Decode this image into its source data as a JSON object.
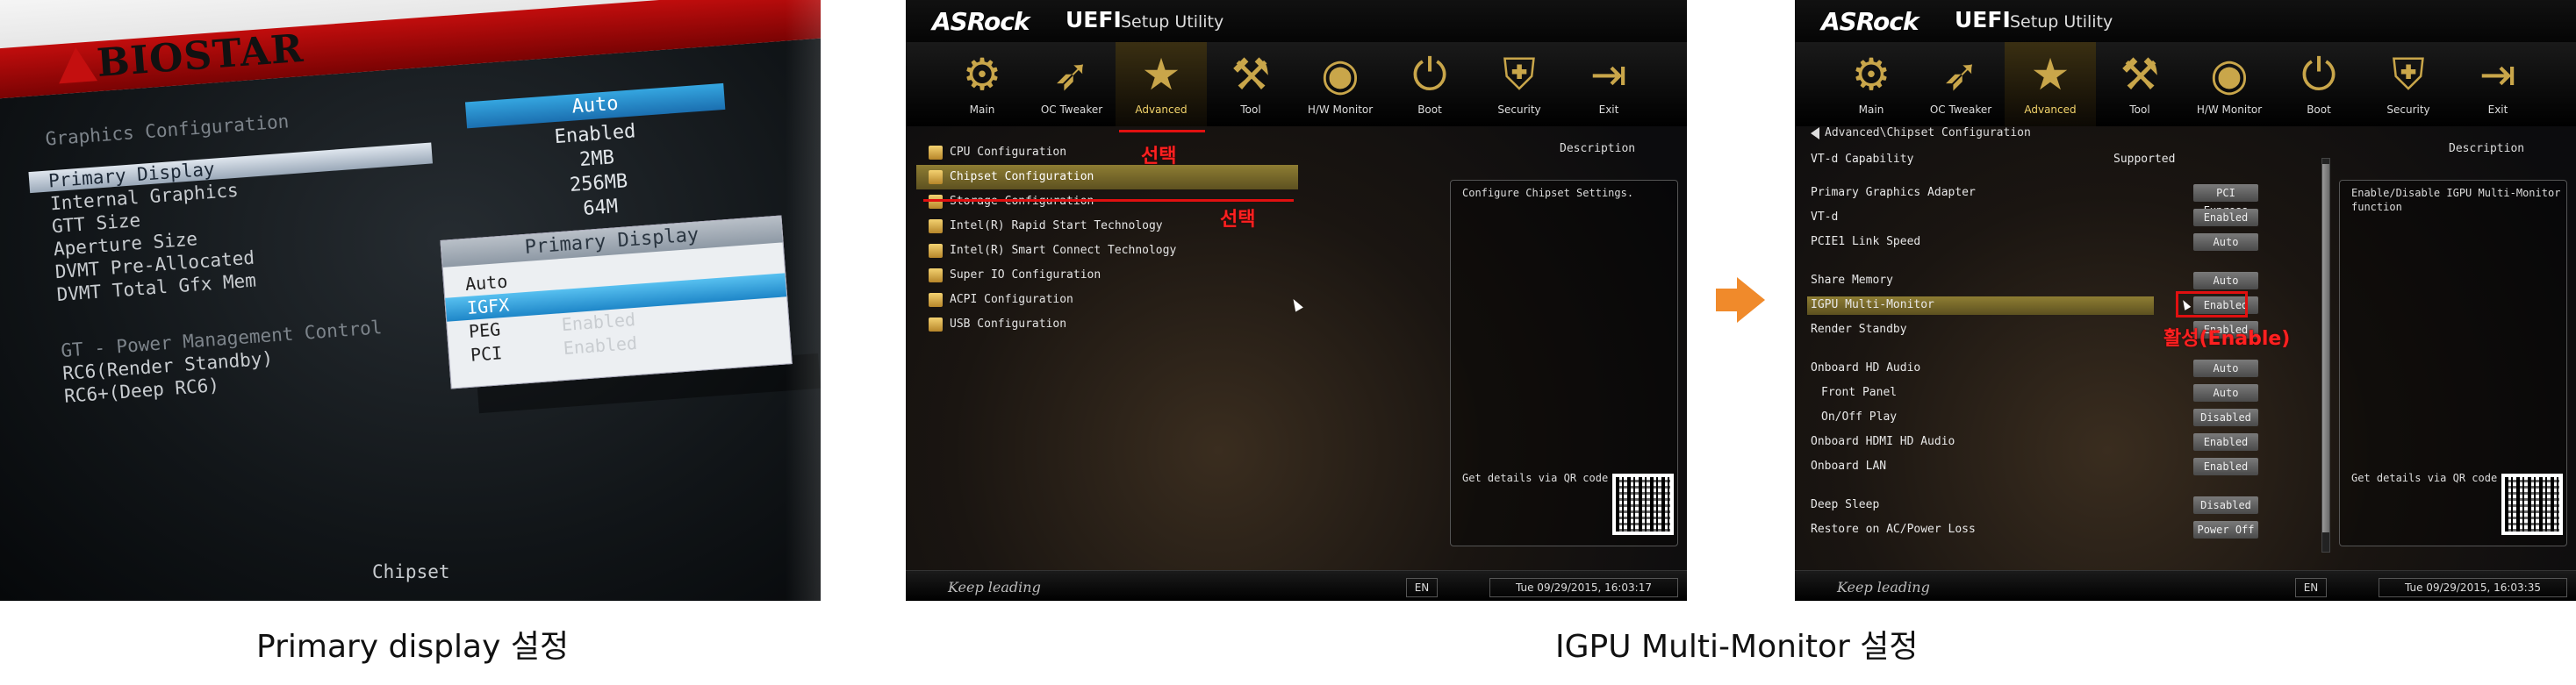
{
  "biostar": {
    "brand": "BIOSTAR",
    "section_title": "Graphics Configuration",
    "items": [
      "Primary Display",
      "Internal Graphics",
      "GTT Size",
      "Aperture Size",
      "DVMT Pre-Allocated",
      "DVMT Total Gfx Mem"
    ],
    "values": [
      "Auto",
      "Enabled",
      "2MB",
      "256MB",
      "64M"
    ],
    "popup_title": "Primary Display",
    "popup_options": [
      "Auto",
      "IGFX",
      "PEG",
      "PCI"
    ],
    "popup_ghost": [
      "Enabled",
      "Enabled"
    ],
    "power_items": [
      "GT - Power Management Control",
      "RC6(Render Standby)",
      "RC6+(Deep RC6)"
    ],
    "bottom_tab": "Chipset"
  },
  "asrock_common": {
    "brand": "ASRock",
    "uefi": "UEFI",
    "setup_utility": "Setup Utility",
    "nav": [
      "Main",
      "OC Tweaker",
      "Advanced",
      "Tool",
      "H/W Monitor",
      "Boot",
      "Security",
      "Exit"
    ],
    "description_title": "Description",
    "qr_text": "Get details via QR code",
    "slogan": "Keep leading",
    "lang": "EN"
  },
  "asrock1": {
    "menu": [
      "CPU Configuration",
      "Chipset Configuration",
      "Storage Configuration",
      "Intel(R) Rapid Start Technology",
      "Intel(R) Smart Connect Technology",
      "Super IO Configuration",
      "ACPI Configuration",
      "USB Configuration"
    ],
    "selected_index": 1,
    "description": "Configure Chipset Settings.",
    "annotation_nav": "선택",
    "annotation_menu": "선택",
    "datetime": "Tue 09/29/2015, 16:03:17"
  },
  "asrock2": {
    "breadcrumb": "Advanced\\Chipset Configuration",
    "rows": [
      {
        "label": "VT-d Capability",
        "value": "Supported",
        "kind": "text"
      },
      {
        "label": "Primary Graphics Adapter",
        "value": "PCI Express",
        "kind": "btn"
      },
      {
        "label": "VT-d",
        "value": "Enabled",
        "kind": "btn"
      },
      {
        "label": "PCIE1 Link Speed",
        "value": "Auto",
        "kind": "btn"
      },
      {
        "label": "Share Memory",
        "value": "Auto",
        "kind": "btn"
      },
      {
        "label": "IGPU Multi-Monitor",
        "value": "Enabled",
        "kind": "btn"
      },
      {
        "label": "Render Standby",
        "value": "Enabled",
        "kind": "btn"
      },
      {
        "label": "Onboard HD Audio",
        "value": "Auto",
        "kind": "btn"
      },
      {
        "label": "Front Panel",
        "value": "Auto",
        "kind": "btn"
      },
      {
        "label": "On/Off Play",
        "value": "Disabled",
        "kind": "btn"
      },
      {
        "label": "Onboard HDMI HD Audio",
        "value": "Enabled",
        "kind": "btn"
      },
      {
        "label": "Onboard LAN",
        "value": "Enabled",
        "kind": "btn"
      },
      {
        "label": "Deep Sleep",
        "value": "Disabled",
        "kind": "btn"
      },
      {
        "label": "Restore on AC/Power Loss",
        "value": "Power Off",
        "kind": "btn"
      }
    ],
    "description": "Enable/Disable IGPU Multi-Monitor function",
    "annotation": "활성(Enable)",
    "datetime": "Tue 09/29/2015, 16:03:35"
  },
  "captions": {
    "left": "Primary display 설정",
    "right": "IGPU Multi-Monitor 설정"
  },
  "colors": {
    "annotation_red": "#e01010",
    "arrow_orange": "#f08a2b",
    "asrock_gold": "#8e7d33",
    "biostar_blue": "#1e86c8"
  }
}
